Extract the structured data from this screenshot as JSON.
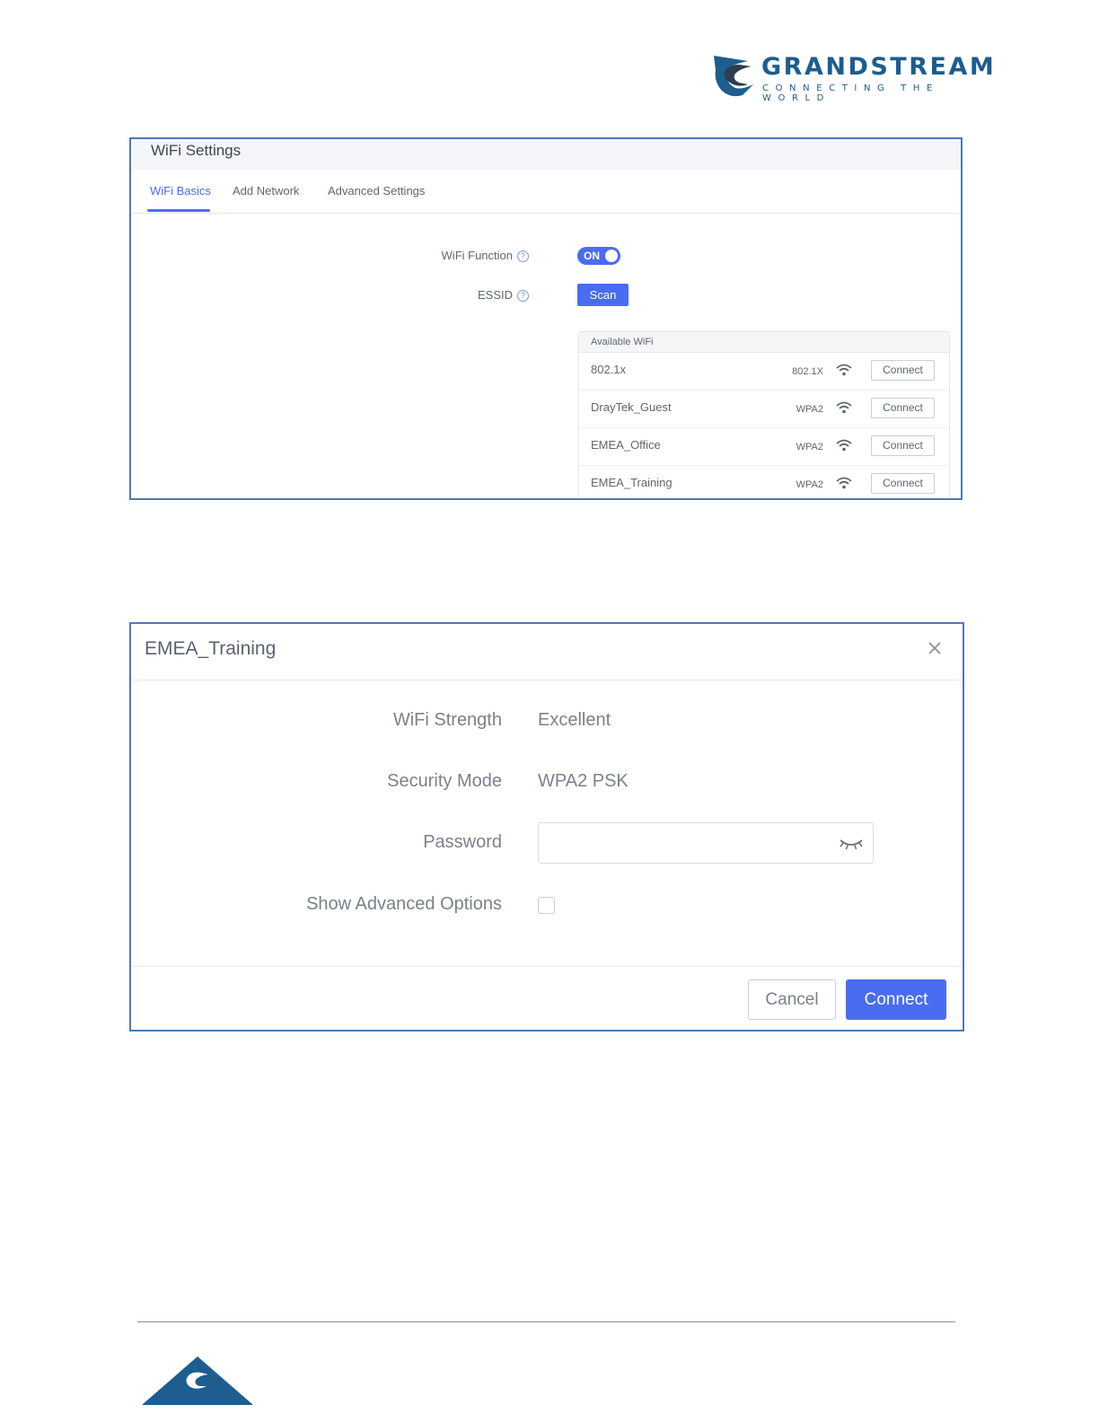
{
  "brand": {
    "name": "GRANDSTREAM",
    "tagline": "CONNECTING THE WORLD",
    "color": "#1d5d8f"
  },
  "wifi_settings": {
    "title": "WiFi Settings",
    "tabs": [
      {
        "label": "WiFi Basics",
        "active": true
      },
      {
        "label": "Add Network",
        "active": false
      },
      {
        "label": "Advanced Settings",
        "active": false
      }
    ],
    "wifi_function_label": "WiFi Function",
    "wifi_function_state": "ON",
    "essid_label": "ESSID",
    "scan_label": "Scan",
    "available_header": "Available WiFi",
    "networks": [
      {
        "name": "802.1x",
        "security": "802.1X",
        "connect": "Connect"
      },
      {
        "name": "DrayTek_Guest",
        "security": "WPA2",
        "connect": "Connect"
      },
      {
        "name": "EMEA_Office",
        "security": "WPA2",
        "connect": "Connect"
      },
      {
        "name": "EMEA_Training",
        "security": "WPA2",
        "connect": "Connect"
      }
    ],
    "accent": "#4a6cf0"
  },
  "dialog": {
    "title": "EMEA_Training",
    "wifi_strength_label": "WiFi Strength",
    "wifi_strength_value": "Excellent",
    "security_mode_label": "Security Mode",
    "security_mode_value": "WPA2 PSK",
    "password_label": "Password",
    "password_value": "",
    "show_advanced_label": "Show Advanced Options",
    "show_advanced_checked": false,
    "cancel_label": "Cancel",
    "connect_label": "Connect"
  }
}
